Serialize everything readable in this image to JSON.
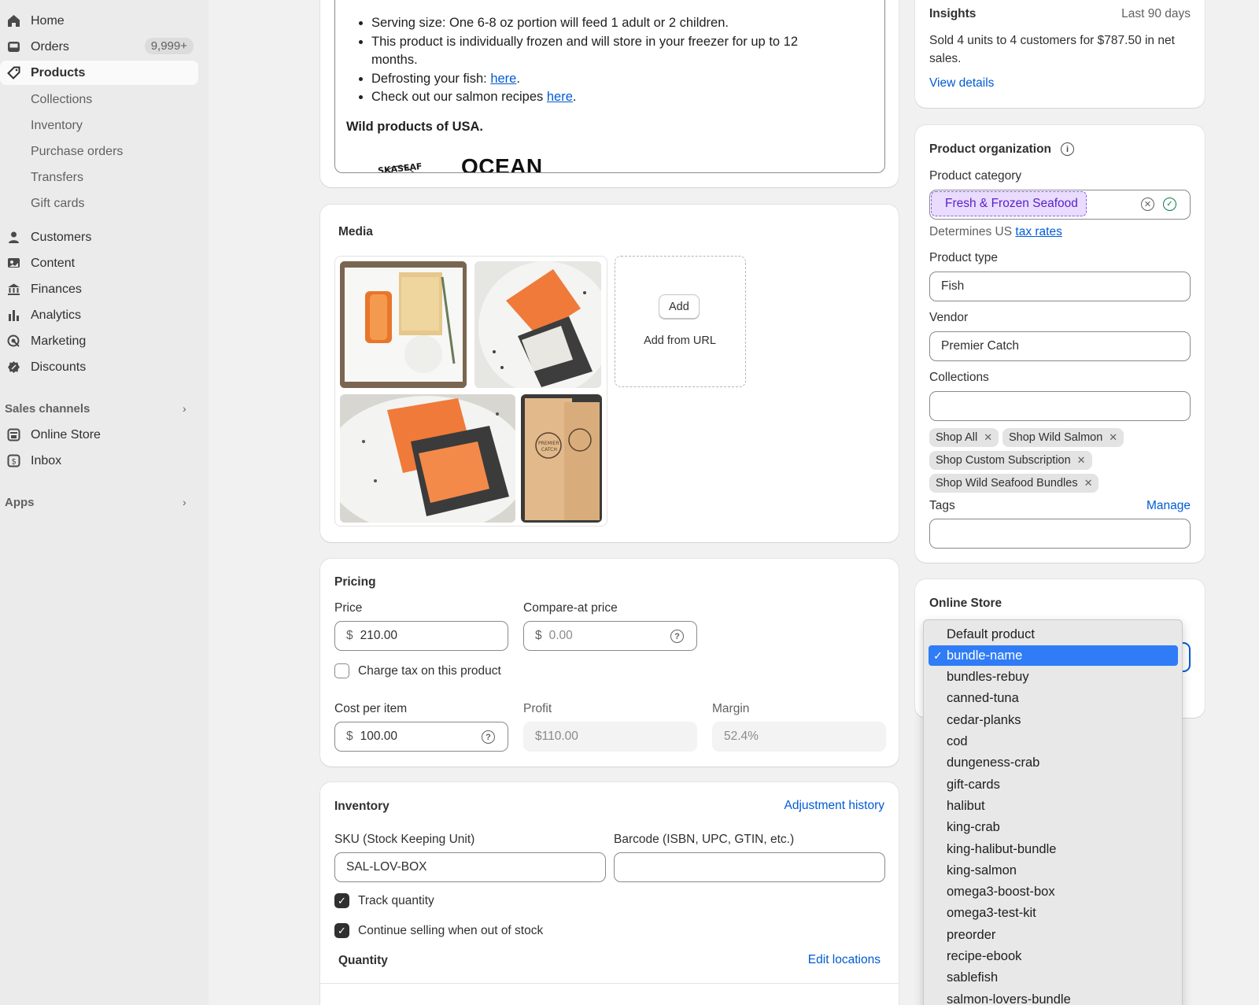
{
  "sidebar": {
    "items": [
      {
        "label": "Home"
      },
      {
        "label": "Orders",
        "badge": "9,999+"
      },
      {
        "label": "Products"
      },
      {
        "label": "Customers"
      },
      {
        "label": "Content"
      },
      {
        "label": "Finances"
      },
      {
        "label": "Analytics"
      },
      {
        "label": "Marketing"
      },
      {
        "label": "Discounts"
      }
    ],
    "product_sub": [
      "Collections",
      "Inventory",
      "Purchase orders",
      "Transfers",
      "Gift cards"
    ],
    "sales_channels": {
      "heading": "Sales channels",
      "items": [
        "Online Store",
        "Inbox"
      ]
    },
    "apps_heading": "Apps"
  },
  "description": {
    "bullets": [
      "Serving size: One 6-8 oz portion will feed 1 adult or 2 children.",
      "This product is individually frozen and will store in your freezer for up to 12 months.",
      "Defrosting your fish: ",
      "Check out our salmon recipes "
    ],
    "link_text": "here",
    "closing": "Wild products of USA.",
    "logo_text": "OCEAN",
    "logo_partial": "SKASEAF"
  },
  "media": {
    "title": "Media",
    "add_label": "Add",
    "add_url_label": "Add from URL",
    "board_text": "PREMIER CATCH"
  },
  "pricing": {
    "title": "Pricing",
    "price_label": "Price",
    "price_currency": "$",
    "price_value": "210.00",
    "compare_label": "Compare-at price",
    "compare_value": "0.00",
    "charge_tax_label": "Charge tax on this product",
    "cost_label": "Cost per item",
    "cost_value": "100.00",
    "profit_label": "Profit",
    "profit_value": "$110.00",
    "margin_label": "Margin",
    "margin_value": "52.4%"
  },
  "inventory": {
    "title": "Inventory",
    "adjustment_link": "Adjustment history",
    "sku_label": "SKU (Stock Keeping Unit)",
    "sku_value": "SAL-LOV-BOX",
    "barcode_label": "Barcode (ISBN, UPC, GTIN, etc.)",
    "barcode_value": "",
    "track_label": "Track quantity",
    "continue_label": "Continue selling when out of stock",
    "quantity_label": "Quantity",
    "edit_locations": "Edit locations"
  },
  "insights": {
    "title": "Insights",
    "period": "Last 90 days",
    "summary": "Sold 4 units to 4 customers for $787.50 in net sales.",
    "view_details": "View details"
  },
  "organization": {
    "title": "Product organization",
    "category_label": "Product category",
    "category_value": "Fresh & Frozen Seafood",
    "determines_text": "Determines US ",
    "tax_link": "tax rates",
    "type_label": "Product type",
    "type_value": "Fish",
    "vendor_label": "Vendor",
    "vendor_value": "Premier Catch",
    "collections_label": "Collections",
    "collections": [
      "Shop All",
      "Shop Wild Salmon",
      "Shop Custom Subscription",
      "Shop Wild Seafood Bundles"
    ],
    "tags_label": "Tags",
    "manage_link": "Manage"
  },
  "online_store": {
    "title": "Online Store",
    "selected": "bundle-name",
    "options": [
      "Default product",
      "bundle-name",
      "bundles-rebuy",
      "canned-tuna",
      "cedar-planks",
      "cod",
      "dungeness-crab",
      "gift-cards",
      "halibut",
      "king-crab",
      "king-halibut-bundle",
      "king-salmon",
      "omega3-boost-box",
      "omega3-test-kit",
      "preorder",
      "recipe-ebook",
      "sablefish",
      "salmon-lovers-bundle"
    ]
  },
  "colors": {
    "accent": "#005bd3",
    "selected_option": "#2f7cf6",
    "category_tag": "#e9dcff"
  }
}
